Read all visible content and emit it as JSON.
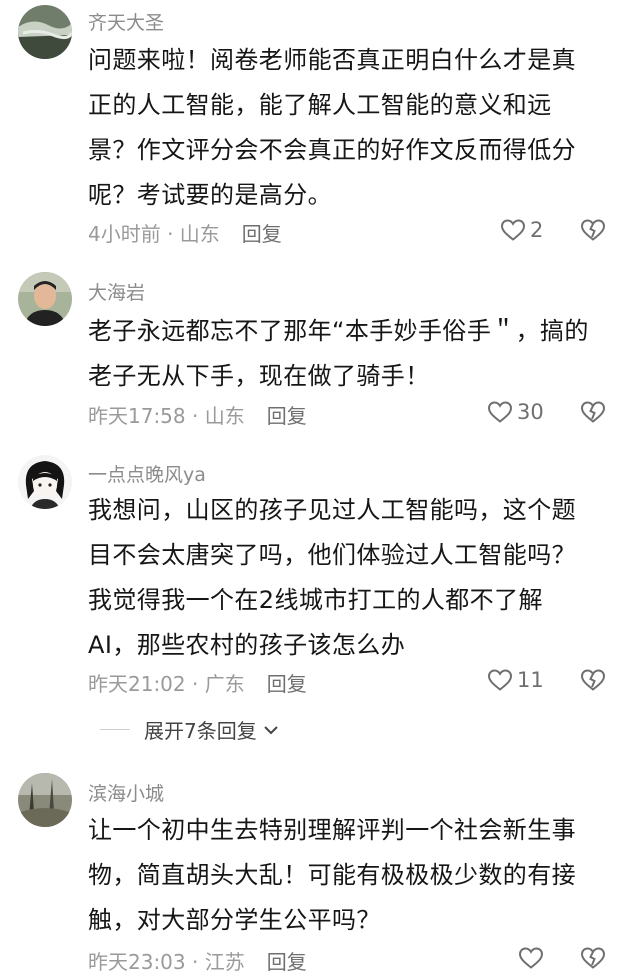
{
  "comments": [
    {
      "username": "齐天大圣",
      "text": "问题来啦！阅卷老师能否真正明白什么才是真\n正的人工智能，能了解人工智能的意义和远\n景？作文评分会不会真正的好作文反而得低分\n呢？考试要的是高分。",
      "time_location": "4小时前 · 山东",
      "reply_label": "回复",
      "likes": "2"
    },
    {
      "username": "大海岩",
      "text": "老子永远都忘不了那年“本手妙手俗手＂，搞的\n老子无从下手，现在做了骑手！",
      "time_location": "昨天17:58 · 山东",
      "reply_label": "回复",
      "likes": "30"
    },
    {
      "username": "一点点晚风ya",
      "text": "我想问，山区的孩子见过人工智能吗，这个题\n目不会太唐突了吗，他们体验过人工智能吗？\n我觉得我一个在2线城市打工的人都不了解\nAI，那些农村的孩子该怎么办",
      "time_location": "昨天21:02 · 广东",
      "reply_label": "回复",
      "likes": "11"
    },
    {
      "username": "滨海小城",
      "text": "让一个初中生去特别理解评判一个社会新生事\n物，简直胡头大乱！可能有极极极少数的有接\n触，对大部分学生公平吗？",
      "time_location": "昨天23:03 · 江苏",
      "reply_label": "回复",
      "likes": ""
    }
  ],
  "expand_replies": "展开7条回复"
}
